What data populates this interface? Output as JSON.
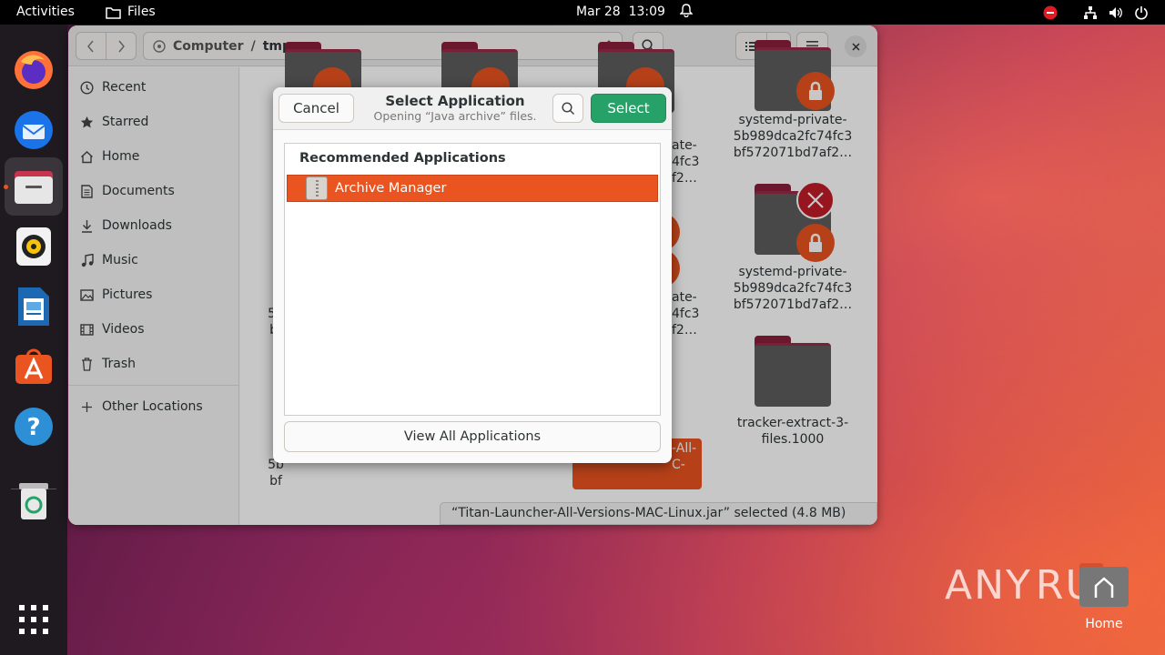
{
  "topbar": {
    "activities": "Activities",
    "app_name": "Files",
    "date": "Mar 28",
    "time": "13:09"
  },
  "dock": {
    "items": [
      "firefox-icon",
      "thunderbird-icon",
      "files-icon",
      "rhythmbox-icon",
      "libreoffice-writer-icon",
      "app-center-icon",
      "help-icon",
      "trash-icon",
      "show-apps-icon"
    ]
  },
  "file_manager": {
    "path": [
      "Computer",
      "tmp"
    ],
    "sidebar": [
      {
        "label": "Recent",
        "icon": "clock-icon"
      },
      {
        "label": "Starred",
        "icon": "star-icon"
      },
      {
        "label": "Home",
        "icon": "home-icon"
      },
      {
        "label": "Documents",
        "icon": "document-icon"
      },
      {
        "label": "Downloads",
        "icon": "download-icon"
      },
      {
        "label": "Music",
        "icon": "music-icon"
      },
      {
        "label": "Pictures",
        "icon": "picture-icon"
      },
      {
        "label": "Videos",
        "icon": "video-icon"
      },
      {
        "label": "Trash",
        "icon": "trash-icon"
      },
      {
        "label": "Other Locations",
        "icon": "plus-icon"
      }
    ],
    "files": [
      {
        "line1": "systemd-private-",
        "line2": "5b989dca2fc74fc3",
        "line3": "bf572071bd7af2…"
      },
      {
        "line1": "systemd-private-",
        "line2": "5b989dca2fc74fc3",
        "line3": "bf572071bd7af2…"
      },
      {
        "line1": "tracker-extract-3-",
        "line2": "files.1000"
      }
    ],
    "partial_col2": {
      "a": [
        "ate-",
        "4fc3",
        "f2…"
      ],
      "b": [
        "ate-",
        "4fc3",
        "f2…"
      ],
      "c": [
        "-All-",
        "C-"
      ]
    },
    "partial_col0": {
      "a": [
        "s"
      ],
      "b": [
        "s",
        "5b",
        "bf"
      ],
      "c": [
        "s",
        "5b",
        "bf"
      ]
    },
    "status": "“Titan-Launcher-All-Versions-MAC-Linux.jar” selected  (4.8 MB)"
  },
  "dialog": {
    "cancel": "Cancel",
    "title": "Select Application",
    "subtitle": "Opening “Java archive” files.",
    "select": "Select",
    "recommended_heading": "Recommended Applications",
    "apps": [
      {
        "name": "Archive Manager",
        "selected": true
      }
    ],
    "view_all": "View All Applications"
  },
  "desktop": {
    "home_label": "Home",
    "watermark": "ANY RUN"
  },
  "colors": {
    "accent": "#e95420",
    "select_button": "#26a269",
    "lock_emblem": "#e95420",
    "error_emblem": "#c01c28"
  }
}
